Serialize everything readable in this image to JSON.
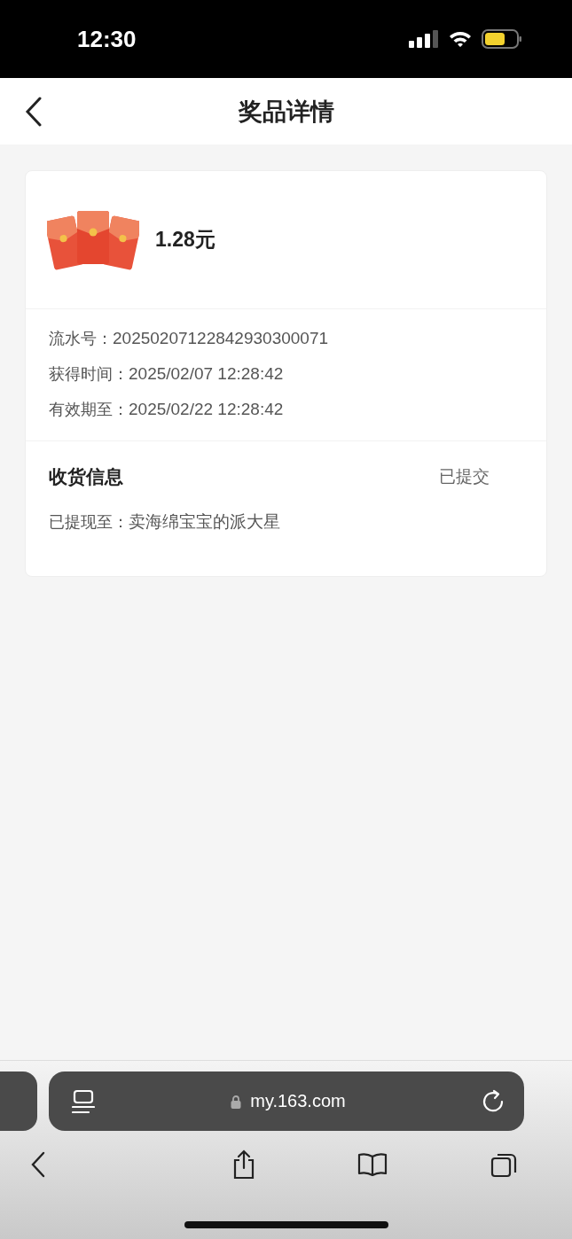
{
  "status_bar": {
    "time": "12:30"
  },
  "nav": {
    "title": "奖品详情"
  },
  "prize": {
    "amount": "1.28元"
  },
  "details": [
    {
      "label": "流水号：",
      "value": "20250207122842930300071"
    },
    {
      "label": "获得时间：",
      "value": "2025/02/07 12:28:42"
    },
    {
      "label": "有效期至：",
      "value": "2025/02/22 12:28:42"
    }
  ],
  "receipt": {
    "title": "收货信息",
    "status": "已提交",
    "label": "已提现至：",
    "value": "卖海绵宝宝的派大星"
  },
  "browser": {
    "url": "my.163.com"
  }
}
